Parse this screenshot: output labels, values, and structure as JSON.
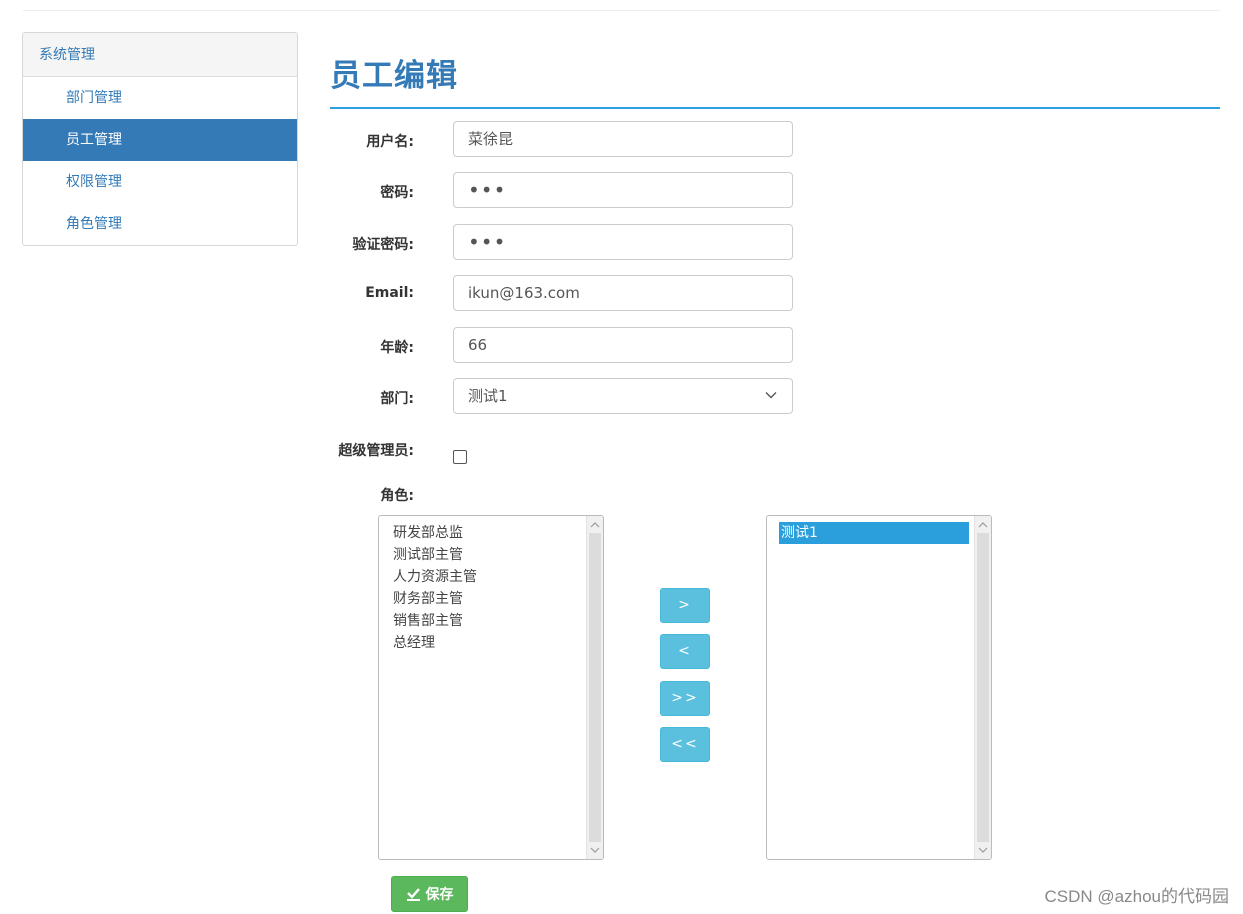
{
  "sidebar": {
    "header": "系统管理",
    "items": [
      {
        "label": "部门管理"
      },
      {
        "label": "员工管理"
      },
      {
        "label": "权限管理"
      },
      {
        "label": "角色管理"
      }
    ]
  },
  "page": {
    "title": "员工编辑"
  },
  "form": {
    "username_label": "用户名:",
    "username_value": "菜徐昆",
    "password_label": "密码:",
    "password_value": "•••",
    "confirm_label": "验证密码:",
    "confirm_value": "•••",
    "email_label": "Email:",
    "email_value": "ikun@163.com",
    "age_label": "年龄:",
    "age_value": "66",
    "dept_label": "部门:",
    "dept_selected": "测试1",
    "super_admin_label": "超级管理员:",
    "super_admin_checked": false,
    "role_label": "角色:"
  },
  "roles": {
    "available": [
      "研发部总监",
      "测试部主管",
      "人力资源主管",
      "财务部主管",
      "销售部主管",
      "总经理"
    ],
    "selected": [
      "测试1"
    ]
  },
  "transfer": {
    "move_right": ">",
    "move_left": "<",
    "move_all_right": ">>",
    "move_all_left": "<<"
  },
  "actions": {
    "save_label": "保存"
  },
  "watermark": "CSDN @azhou的代码园",
  "colors": {
    "primary": "#337ab7",
    "accent_rule": "#2aa0e0",
    "info_button": "#5bc0de",
    "success_button": "#5cb85c",
    "list_selected": "#2a9fdb"
  }
}
